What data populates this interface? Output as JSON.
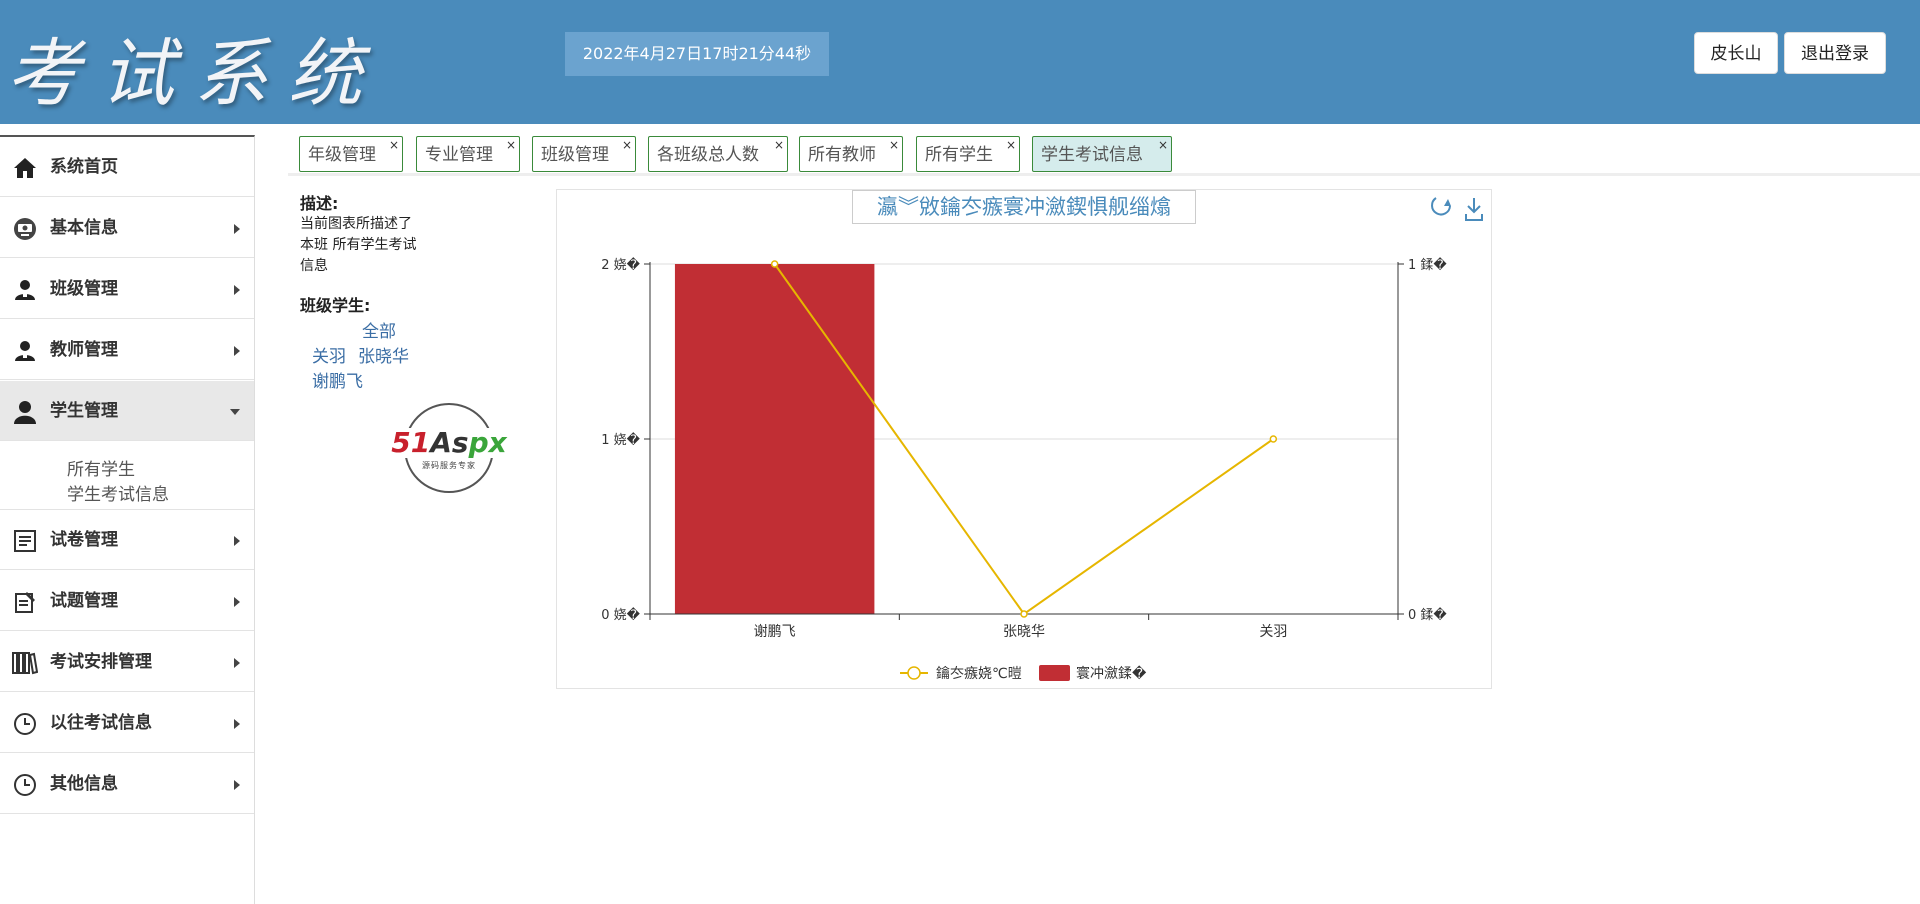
{
  "header": {
    "logo": "考试系统",
    "datetime": "2022年4月27日17时21分44秒",
    "user_button": "皮长山",
    "logout_button": "退出登录"
  },
  "sidebar": {
    "items": [
      {
        "label": "系统首页",
        "icon": "home-icon"
      },
      {
        "label": "基本信息",
        "icon": "dashboard-icon"
      },
      {
        "label": "班级管理",
        "icon": "users-icon"
      },
      {
        "label": "教师管理",
        "icon": "users-icon"
      },
      {
        "label": "学生管理",
        "icon": "user-icon"
      },
      {
        "label": "试卷管理",
        "icon": "document-icon"
      },
      {
        "label": "试题管理",
        "icon": "edit-icon"
      },
      {
        "label": "考试安排管理",
        "icon": "books-icon"
      },
      {
        "label": "以往考试信息",
        "icon": "clock-icon"
      },
      {
        "label": "其他信息",
        "icon": "clock-icon"
      }
    ],
    "subitems": [
      "所有学生",
      "学生考试信息"
    ]
  },
  "tabs": [
    {
      "label": "年级管理",
      "close": "×"
    },
    {
      "label": "专业管理",
      "close": "×"
    },
    {
      "label": "班级管理",
      "close": "×"
    },
    {
      "label": "各班级总人数",
      "close": "×"
    },
    {
      "label": "所有教师",
      "close": "×"
    },
    {
      "label": "所有学生",
      "close": "×"
    },
    {
      "label": "学生考试信息",
      "close": "×"
    }
  ],
  "description": {
    "title": "描述:",
    "lines": [
      "当前图表所描述了",
      "本班 所有学生考试",
      "信息"
    ]
  },
  "students": {
    "title": "班级学生:",
    "all": "全部",
    "names": [
      "关羽",
      "张晓华",
      "谢鹏飞"
    ]
  },
  "badge": {
    "part1": "51",
    "part2": "As",
    "part3": "px",
    "subtitle": "源码服务专家"
  },
  "colors": {
    "header_bg": "#4a8bbb",
    "bar": "#c12e34",
    "line": "#e6b600",
    "link": "#3b6ea5"
  },
  "chart_data": {
    "type": "bar",
    "title": "瀛︾敓鑰冭瘯寰冲瀲鍥惧舰缁熻",
    "categories": [
      "谢鹏飞",
      "张晓华",
      "关羽"
    ],
    "series": [
      {
        "name": "鑰冭瘯娆℃暟",
        "type": "line",
        "axis": "left",
        "values": [
          2,
          0,
          1
        ],
        "color": "#e6b600"
      },
      {
        "name": "寰冲瀲鍒�",
        "type": "bar",
        "axis": "right",
        "values": [
          1,
          0,
          0
        ],
        "color": "#c12e34"
      }
    ],
    "y_left": {
      "min": 0,
      "max": 2,
      "ticks": [
        "0 娆�",
        "1 娆�",
        "2 娆�"
      ]
    },
    "y_right": {
      "min": 0,
      "max": 1,
      "ticks": [
        "0 鍒�",
        "1 鍒�"
      ]
    },
    "grid": true,
    "legend": "bottom"
  }
}
